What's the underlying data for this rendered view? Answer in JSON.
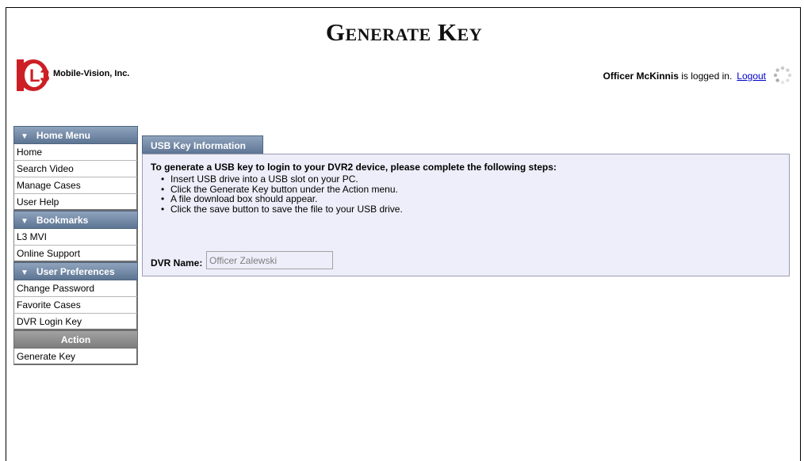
{
  "header": {
    "title": "Generate Key",
    "company": "Mobile-Vision, Inc.",
    "logo_text": "L3",
    "user_name": "Officer McKinnis",
    "logged_in_suffix": " is logged in.",
    "logout_label": "Logout"
  },
  "sidebar": {
    "home_menu": {
      "title": "Home Menu",
      "items": [
        "Home",
        "Search Video",
        "Manage Cases",
        "User Help"
      ]
    },
    "bookmarks": {
      "title": "Bookmarks",
      "items": [
        "L3 MVI",
        "Online Support"
      ]
    },
    "user_preferences": {
      "title": "User Preferences",
      "items": [
        "Change Password",
        "Favorite Cases",
        "DVR Login Key"
      ]
    },
    "action": {
      "title": "Action",
      "items": [
        "Generate Key"
      ]
    }
  },
  "main": {
    "tab_label": "USB Key Information",
    "intro": "To generate a USB key to login to your DVR2 device, please complete the following steps:",
    "steps": [
      "Insert USB drive into a USB slot on your PC.",
      "Click the Generate Key button under the Action menu.",
      "A file download box should appear.",
      "Click the save button to save the file to your USB drive."
    ],
    "dvr_name_label": "DVR Name:",
    "dvr_name_value": "Officer Zalewski"
  },
  "colors": {
    "menu_header": "#6f86a3",
    "action_header": "#8c8c8c",
    "panel_bg": "#eeeefa",
    "link": "#0000cc",
    "logo_red": "#cc1f25"
  },
  "icons": {
    "collapse": "triangle-down-icon",
    "loading": "spinner-icon"
  }
}
